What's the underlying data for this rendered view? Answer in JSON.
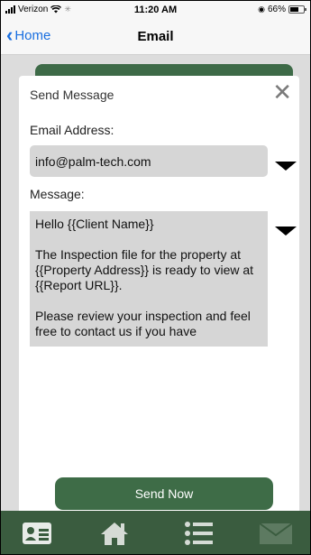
{
  "status_bar": {
    "carrier": "Verizon",
    "time": "11:20 AM",
    "battery": "66%"
  },
  "nav": {
    "back_label": "Home",
    "title": "Email"
  },
  "modal": {
    "title": "Send Message",
    "email_label": "Email Address:",
    "email_value": "info@palm-tech.com",
    "message_label": "Message:",
    "message_lines": [
      "Hello {{Client Name}}",
      "The Inspection file for the property at {{Property Address}} is ready to view at {{Report URL}}.",
      "Please review your inspection and feel free to contact us if you have"
    ],
    "send_label": "Send Now"
  },
  "tab_bar": {
    "icons": [
      "contact-card-icon",
      "home-icon",
      "list-icon",
      "mail-icon"
    ]
  },
  "colors": {
    "accent_green": "#3e6c47",
    "link_blue": "#1a6fe0",
    "field_gray": "#d6d6d6"
  }
}
